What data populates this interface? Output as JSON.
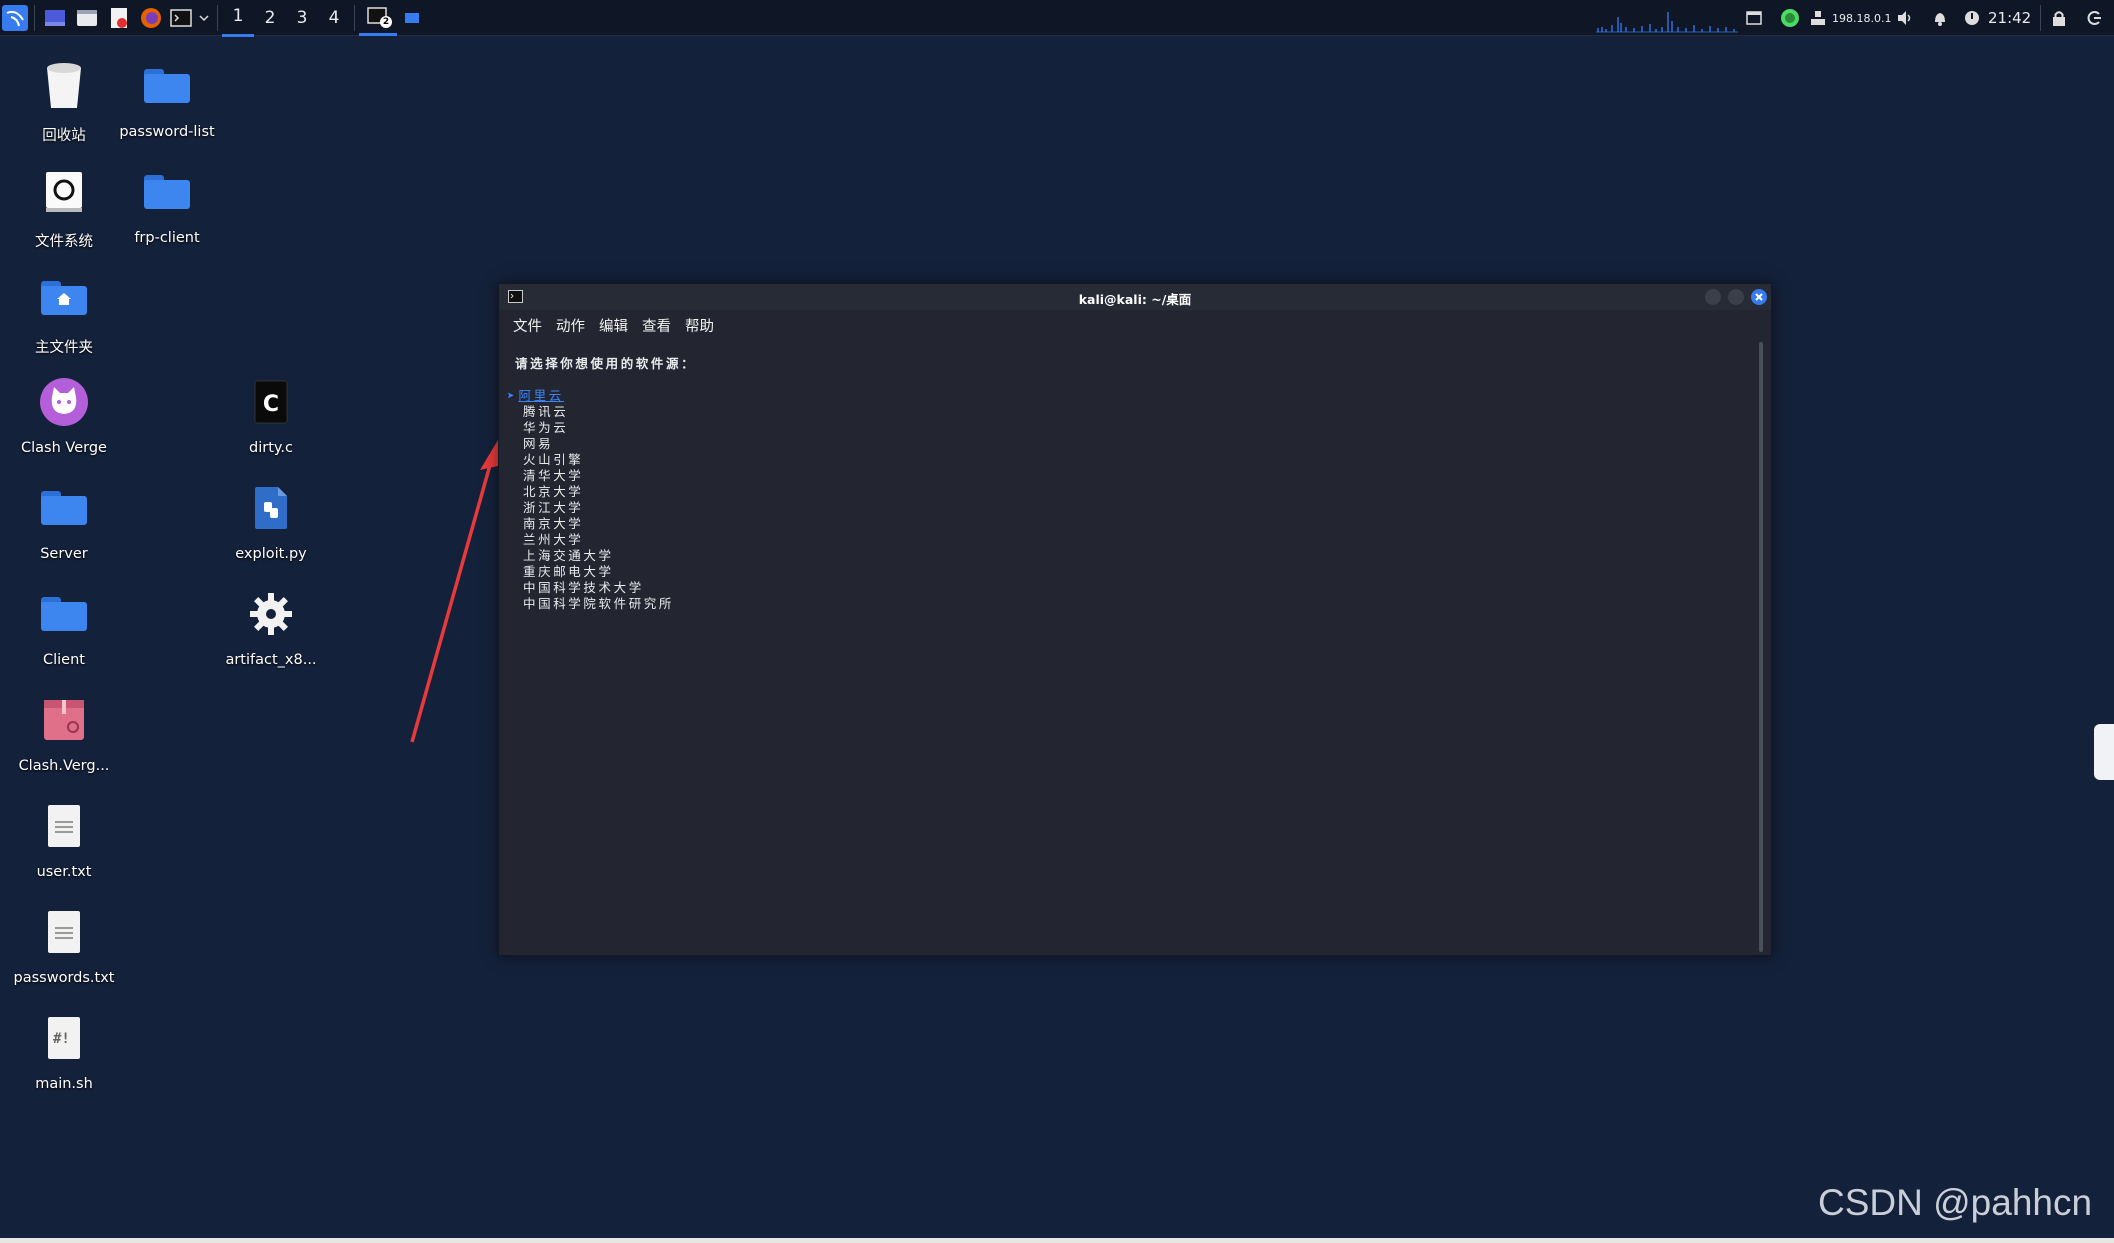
{
  "panel": {
    "workspaces": [
      "1",
      "2",
      "3",
      "4"
    ],
    "active_workspace": "1",
    "taskbar_badge": "2",
    "ip_address": "198.18.0.1",
    "clock": "21:42"
  },
  "desktop": {
    "icons": [
      {
        "label": "回收站",
        "icon": "trash-icon"
      },
      {
        "label": "password-list",
        "icon": "folder-icon"
      },
      {
        "label": "文件系统",
        "icon": "drive-icon"
      },
      {
        "label": "frp-client",
        "icon": "folder-icon"
      },
      {
        "label": "主文件夹",
        "icon": "home-folder-icon"
      },
      {
        "label": "Clash Verge",
        "icon": "cat-icon"
      },
      {
        "label": "dirty.c",
        "icon": "c-file-icon"
      },
      {
        "label": "Server",
        "icon": "folder-icon"
      },
      {
        "label": "exploit.py",
        "icon": "python-file-icon"
      },
      {
        "label": "Client",
        "icon": "folder-icon"
      },
      {
        "label": "artifact_x8...",
        "icon": "gear-icon"
      },
      {
        "label": "Clash.Verg...",
        "icon": "package-icon"
      },
      {
        "label": "user.txt",
        "icon": "text-file-icon"
      },
      {
        "label": "passwords.txt",
        "icon": "text-file-icon"
      },
      {
        "label": "main.sh",
        "icon": "script-file-icon"
      }
    ]
  },
  "terminal": {
    "title": "kali@kali: ~/桌面",
    "menu": [
      "文件",
      "动作",
      "编辑",
      "查看",
      "帮助"
    ],
    "prompt": "请选择你想使用的软件源：",
    "selected_marker": "➤",
    "options": [
      "阿里云",
      "腾讯云",
      "华为云",
      "网易",
      "火山引擎",
      "清华大学",
      "北京大学",
      "浙江大学",
      "南京大学",
      "兰州大学",
      "上海交通大学",
      "重庆邮电大学",
      "中国科学技术大学",
      "中国科学院软件研究所"
    ]
  },
  "watermark": "CSDN @pahhcn",
  "colors": {
    "desktop_bg": "#14213a",
    "panel_bg": "#0f1726",
    "terminal_bg": "#232630",
    "accent": "#367bf0",
    "arrow": "#e83a3a"
  }
}
